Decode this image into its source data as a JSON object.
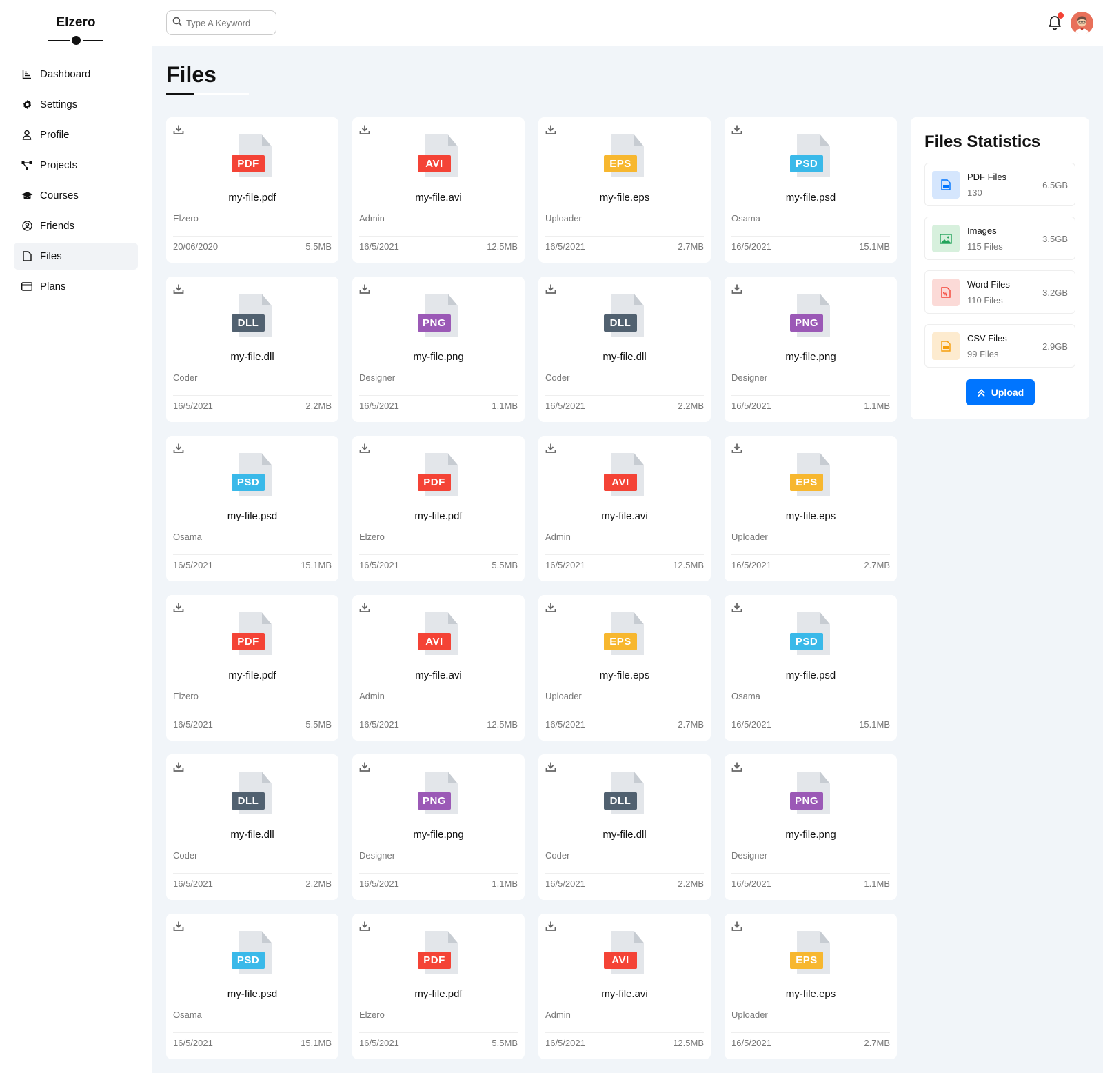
{
  "sidebar": {
    "brand": "Elzero",
    "items": [
      {
        "label": "Dashboard",
        "icon": "chart-icon"
      },
      {
        "label": "Settings",
        "icon": "gear-icon"
      },
      {
        "label": "Profile",
        "icon": "user-icon"
      },
      {
        "label": "Projects",
        "icon": "diagram-icon"
      },
      {
        "label": "Courses",
        "icon": "graduation-cap-icon"
      },
      {
        "label": "Friends",
        "icon": "user-circle-icon"
      },
      {
        "label": "Files",
        "icon": "file-icon",
        "active": true
      },
      {
        "label": "Plans",
        "icon": "credit-card-icon"
      }
    ]
  },
  "header": {
    "search_placeholder": "Type A Keyword",
    "notification_icon": "bell-icon",
    "has_unread": true
  },
  "page": {
    "title": "Files"
  },
  "colors": {
    "PDF": "#f44336",
    "AVI": "#f44336",
    "EPS": "#f7b72f",
    "PSD": "#3ab9e9",
    "DLL": "#516170",
    "PNG": "#9b59b6",
    "accent": "#0075ff"
  },
  "files": [
    {
      "type": "PDF",
      "name": "my-file.pdf",
      "owner": "Elzero",
      "date": "20/06/2020",
      "size": "5.5MB"
    },
    {
      "type": "AVI",
      "name": "my-file.avi",
      "owner": "Admin",
      "date": "16/5/2021",
      "size": "12.5MB"
    },
    {
      "type": "EPS",
      "name": "my-file.eps",
      "owner": "Uploader",
      "date": "16/5/2021",
      "size": "2.7MB"
    },
    {
      "type": "PSD",
      "name": "my-file.psd",
      "owner": "Osama",
      "date": "16/5/2021",
      "size": "15.1MB"
    },
    {
      "type": "DLL",
      "name": "my-file.dll",
      "owner": "Coder",
      "date": "16/5/2021",
      "size": "2.2MB"
    },
    {
      "type": "PNG",
      "name": "my-file.png",
      "owner": "Designer",
      "date": "16/5/2021",
      "size": "1.1MB"
    },
    {
      "type": "DLL",
      "name": "my-file.dll",
      "owner": "Coder",
      "date": "16/5/2021",
      "size": "2.2MB"
    },
    {
      "type": "PNG",
      "name": "my-file.png",
      "owner": "Designer",
      "date": "16/5/2021",
      "size": "1.1MB"
    },
    {
      "type": "PSD",
      "name": "my-file.psd",
      "owner": "Osama",
      "date": "16/5/2021",
      "size": "15.1MB"
    },
    {
      "type": "PDF",
      "name": "my-file.pdf",
      "owner": "Elzero",
      "date": "16/5/2021",
      "size": "5.5MB"
    },
    {
      "type": "AVI",
      "name": "my-file.avi",
      "owner": "Admin",
      "date": "16/5/2021",
      "size": "12.5MB"
    },
    {
      "type": "EPS",
      "name": "my-file.eps",
      "owner": "Uploader",
      "date": "16/5/2021",
      "size": "2.7MB"
    },
    {
      "type": "PDF",
      "name": "my-file.pdf",
      "owner": "Elzero",
      "date": "16/5/2021",
      "size": "5.5MB"
    },
    {
      "type": "AVI",
      "name": "my-file.avi",
      "owner": "Admin",
      "date": "16/5/2021",
      "size": "12.5MB"
    },
    {
      "type": "EPS",
      "name": "my-file.eps",
      "owner": "Uploader",
      "date": "16/5/2021",
      "size": "2.7MB"
    },
    {
      "type": "PSD",
      "name": "my-file.psd",
      "owner": "Osama",
      "date": "16/5/2021",
      "size": "15.1MB"
    },
    {
      "type": "DLL",
      "name": "my-file.dll",
      "owner": "Coder",
      "date": "16/5/2021",
      "size": "2.2MB"
    },
    {
      "type": "PNG",
      "name": "my-file.png",
      "owner": "Designer",
      "date": "16/5/2021",
      "size": "1.1MB"
    },
    {
      "type": "DLL",
      "name": "my-file.dll",
      "owner": "Coder",
      "date": "16/5/2021",
      "size": "2.2MB"
    },
    {
      "type": "PNG",
      "name": "my-file.png",
      "owner": "Designer",
      "date": "16/5/2021",
      "size": "1.1MB"
    },
    {
      "type": "PSD",
      "name": "my-file.psd",
      "owner": "Osama",
      "date": "16/5/2021",
      "size": "15.1MB"
    },
    {
      "type": "PDF",
      "name": "my-file.pdf",
      "owner": "Elzero",
      "date": "16/5/2021",
      "size": "5.5MB"
    },
    {
      "type": "AVI",
      "name": "my-file.avi",
      "owner": "Admin",
      "date": "16/5/2021",
      "size": "12.5MB"
    },
    {
      "type": "EPS",
      "name": "my-file.eps",
      "owner": "Uploader",
      "date": "16/5/2021",
      "size": "2.7MB"
    }
  ],
  "stats": {
    "title": "Files Statistics",
    "items": [
      {
        "name": "PDF Files",
        "count": "130",
        "size": "6.5GB",
        "icon": "pdf-file-icon",
        "bg": "#d5e6fd",
        "fg": "#0075ff"
      },
      {
        "name": "Images",
        "count": "115 Files",
        "size": "3.5GB",
        "icon": "image-icon",
        "bg": "#d7f0dd",
        "fg": "#22a35a"
      },
      {
        "name": "Word Files",
        "count": "110 Files",
        "size": "3.2GB",
        "icon": "word-file-icon",
        "bg": "#fbdad7",
        "fg": "#f44336"
      },
      {
        "name": "CSV Files",
        "count": "99 Files",
        "size": "2.9GB",
        "icon": "csv-file-icon",
        "bg": "#fdebcf",
        "fg": "#f59e0b"
      }
    ],
    "upload_label": "Upload"
  }
}
